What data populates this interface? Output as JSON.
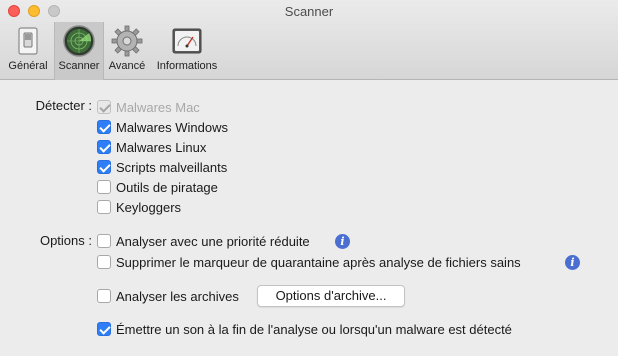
{
  "window": {
    "title": "Scanner"
  },
  "toolbar": {
    "tabs": [
      {
        "label": "Général",
        "icon": "switch-icon"
      },
      {
        "label": "Scanner",
        "icon": "radar-icon",
        "active": true
      },
      {
        "label": "Avancé",
        "icon": "gear-icon"
      },
      {
        "label": "Informations",
        "icon": "gauge-icon"
      }
    ]
  },
  "detect": {
    "label": "Détecter :",
    "items": [
      {
        "label": "Malwares Mac",
        "checked": true,
        "disabled": true
      },
      {
        "label": "Malwares Windows",
        "checked": true
      },
      {
        "label": "Malwares Linux",
        "checked": true
      },
      {
        "label": "Scripts malveillants",
        "checked": true
      },
      {
        "label": "Outils de piratage",
        "checked": false
      },
      {
        "label": "Keyloggers",
        "checked": false
      }
    ]
  },
  "options": {
    "label": "Options :",
    "low_priority": {
      "label": "Analyser avec une priorité réduite",
      "checked": false
    },
    "quarantine": {
      "label": "Supprimer le marqueur de quarantaine après analyse de fichiers sains",
      "checked": false
    },
    "archives": {
      "label": "Analyser les archives",
      "checked": false
    },
    "archive_button": "Options d'archive...",
    "sound": {
      "label": "Émettre un son à la fin de l'analyse ou lorsqu'un malware est détecté",
      "checked": true
    },
    "info_glyph": "i"
  },
  "colors": {
    "accent": "#2d7ef7",
    "info": "#4a6fd1"
  }
}
